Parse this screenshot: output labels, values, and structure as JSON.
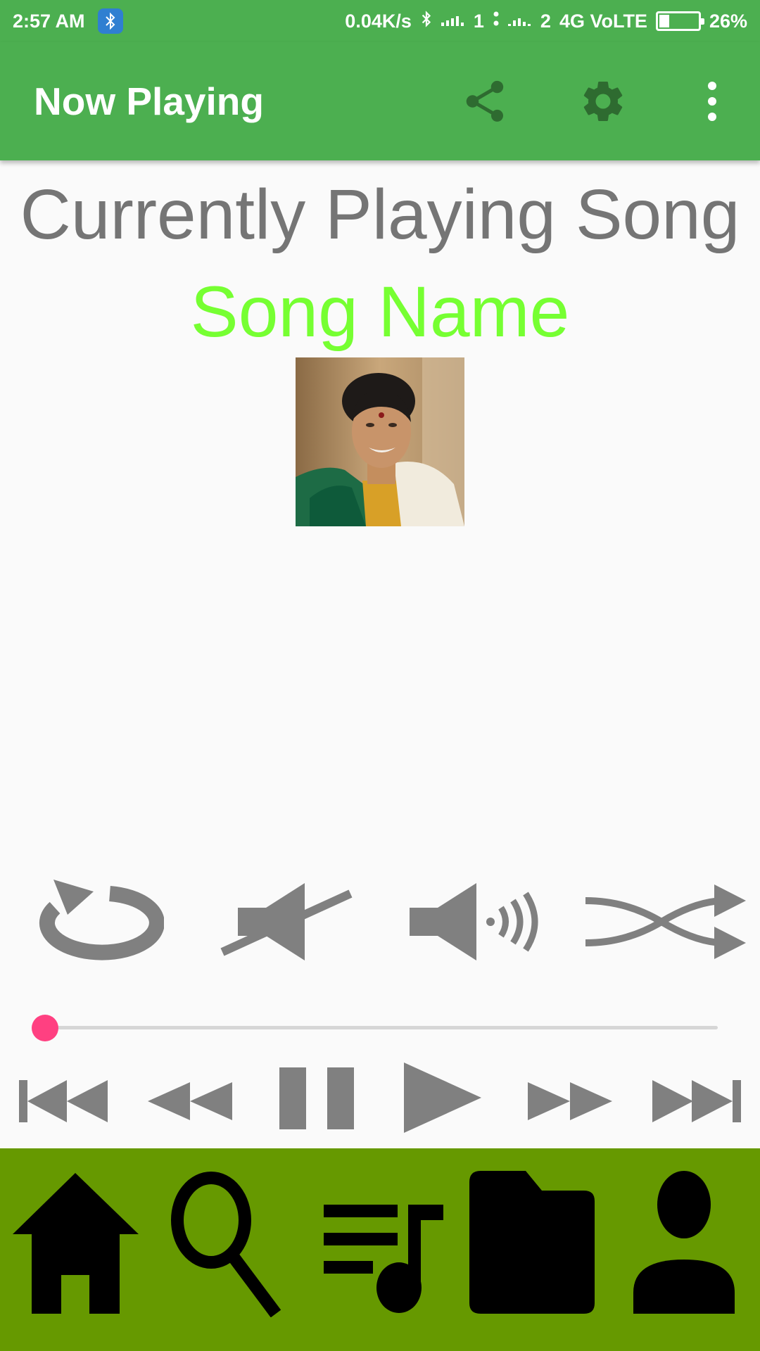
{
  "status_bar": {
    "time": "2:57 AM",
    "net_speed": "0.04K/s",
    "sim1": "1",
    "sim2": "2",
    "network": "4G VoLTE",
    "battery_percent": "26%",
    "battery_level": 0.26
  },
  "app_bar": {
    "title": "Now Playing",
    "actions": [
      "share-icon",
      "settings-icon",
      "more-vert-icon"
    ]
  },
  "main": {
    "heading": "Currently Playing Song",
    "song_name": "Song Name"
  },
  "controls": {
    "row1": [
      "repeat-icon",
      "mute-icon",
      "volume-up-icon",
      "shuffle-icon"
    ],
    "seek_progress": 0.0,
    "row2": [
      "skip-previous-icon",
      "rewind-icon",
      "pause-icon",
      "play-icon",
      "fast-forward-icon",
      "skip-next-icon"
    ]
  },
  "bottom_nav": {
    "items": [
      "home-icon",
      "search-icon",
      "playlist-icon",
      "folder-icon",
      "profile-icon"
    ]
  },
  "colors": {
    "primary": "#4caf50",
    "bottom_nav": "#669900",
    "song_name": "#76ff32",
    "accent": "#ff4081",
    "control_gray": "#808080"
  }
}
